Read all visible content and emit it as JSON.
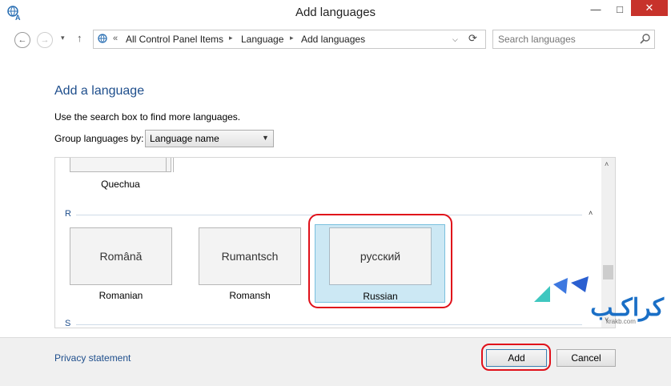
{
  "window": {
    "title": "Add languages",
    "minimize_glyph": "—",
    "maximize_glyph": "□",
    "close_glyph": "✕"
  },
  "nav": {
    "back_glyph": "←",
    "forward_glyph": "→",
    "recent_glyph": "▾",
    "up_glyph": "↑"
  },
  "address": {
    "overflow": "«",
    "breadcrumbs": [
      "All Control Panel Items",
      "Language",
      "Add languages"
    ],
    "separator": "▸",
    "dropdown_glyph": "⌵",
    "refresh_glyph": "⟳"
  },
  "search": {
    "placeholder": "Search languages",
    "icon": "search-icon"
  },
  "content": {
    "heading": "Add a language",
    "description": "Use the search box to find more languages.",
    "group_label": "Group languages by:",
    "group_value": "Language name"
  },
  "list": {
    "partial_tile_label": "Quechua",
    "group_r": {
      "letter": "R",
      "collapse_glyph": "˄",
      "tiles": [
        {
          "native": "Română",
          "label": "Romanian"
        },
        {
          "native": "Rumantsch",
          "label": "Romansh"
        },
        {
          "native": "русский",
          "label": "Russian",
          "selected": true
        }
      ]
    },
    "group_s": {
      "letter": "S"
    },
    "scroll_up_glyph": "˄",
    "scroll_down_glyph": "˅"
  },
  "footer": {
    "privacy_link": "Privacy statement",
    "add_label": "Add",
    "cancel_label": "Cancel"
  },
  "watermark": {
    "text": "کراکـب",
    "url": "krakb.com"
  },
  "colors": {
    "accent_blue": "#1e4e8c",
    "selection": "#cce8f4",
    "highlight_red": "#e0101a",
    "close_red": "#c7322b"
  }
}
